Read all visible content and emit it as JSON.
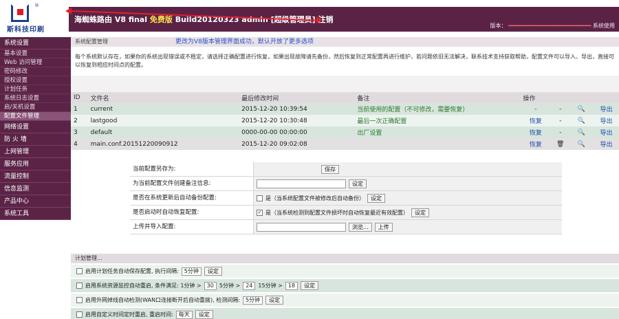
{
  "header": {
    "logo_text": "斯科技印刷",
    "logo_reg": "®",
    "product": "海蜘蛛路由 V8 final",
    "edition": "免费版",
    "build": "Build20120323",
    "user": "admin",
    "role": "[超级管理员]",
    "logout": "注销",
    "right_info": "版本：",
    "right_end": "系统使用"
  },
  "sidebar": {
    "groups": [
      {
        "label": "系统设置",
        "items": [
          "基本设置",
          "Web 访问管理",
          "密码修改",
          "授权设置",
          "计划任务",
          "系统日志设置",
          "启/关机设置",
          "配置文件管理"
        ],
        "active_index": 7
      },
      {
        "label": "网络设置",
        "items": []
      },
      {
        "label": "防 火 墙",
        "items": []
      },
      {
        "label": "上网管理",
        "items": []
      },
      {
        "label": "服务应用",
        "items": []
      },
      {
        "label": "流量控制",
        "items": []
      },
      {
        "label": "信息监测",
        "items": []
      },
      {
        "label": "产品中心",
        "items": []
      },
      {
        "label": "系统工具",
        "items": []
      }
    ]
  },
  "main": {
    "crumb": "系统配置管理",
    "annotation": "更改为V8版本管理界面成功，默认开放了更多选项",
    "description": "每个系统默认存在，如果你的系统出现错误或不稳定，请选择正确配置进行恢复，如果出现故障请先备份，然后恢复到正常配置再进行维护，若问题依旧无法解决，联系技术支持获取帮助，配置文件可以导入、导出，直接可以恢复到相应时间点的配置。",
    "table": {
      "headers": [
        "ID",
        "文件名",
        "最后修改时间",
        "备注",
        "操作"
      ],
      "rows": [
        {
          "id": "1",
          "name": "current",
          "time": "2015-12-20 10:39:54",
          "note": "当前使用的配置（不可修改，需要恢复）",
          "a1": "-",
          "a2": "-",
          "a3": "🔍",
          "a4": "导出"
        },
        {
          "id": "2",
          "name": "lastgood",
          "time": "2015-12-20 10:30:48",
          "note": "最后一次正确配置",
          "a1": "恢复",
          "a2": "-",
          "a3": "🔍",
          "a4": "导出"
        },
        {
          "id": "3",
          "name": "default",
          "time": "0000-00-00 00:00:00",
          "note": "出厂设置",
          "a1": "恢复",
          "a2": "-",
          "a3": "🔍",
          "a4": "导出"
        },
        {
          "id": "4",
          "name": "main.conf.20151220090912",
          "time": "2015-12-20 09:02:08",
          "note": "",
          "a1": "恢复",
          "a2": "🗑",
          "a3": "🔍",
          "a4": "导出"
        }
      ]
    },
    "form": [
      {
        "label": "当前配置另存为:",
        "value": "",
        "button": "保存"
      },
      {
        "label": "为当前配置文件创建备注信息:",
        "value": "",
        "button": "设定"
      },
      {
        "label": "是否在系统更新后自动备份配置:",
        "check_text": "是（当系统配置文件被修改后自动备份）",
        "checked": false,
        "button": "设定"
      },
      {
        "label": "是否启动时自动恢复配置:",
        "check_text": "是（当系统检测到配置文件损坏时自动恢复最近有效配置）",
        "checked": true,
        "button": "设定"
      },
      {
        "label": "上传并导入配置:",
        "browse": "浏览...",
        "button": "上传"
      }
    ],
    "schedule": {
      "title": "计划管理...",
      "rows": [
        {
          "text": "启用计划任务自动保存配置, 执行间隔:",
          "sel": "5分钟",
          "btn": "设定"
        },
        {
          "text": "启用系统资源监控自动重启, 条件满足: 1分钟 >",
          "sel": "30",
          "tail": "5分钟 >",
          "sel2": "24",
          "tail2": "15分钟 >",
          "sel3": "18",
          "btn": "设定"
        },
        {
          "text": "启用外网掉线自动检测(WAN口连接断开后自动重拨), 检测间隔:",
          "sel": "5分钟",
          "btn": "设定"
        },
        {
          "text": "启用自定义时间定时重启, 重启时间:",
          "sel": "每天",
          "btn": "设定"
        }
      ]
    }
  }
}
